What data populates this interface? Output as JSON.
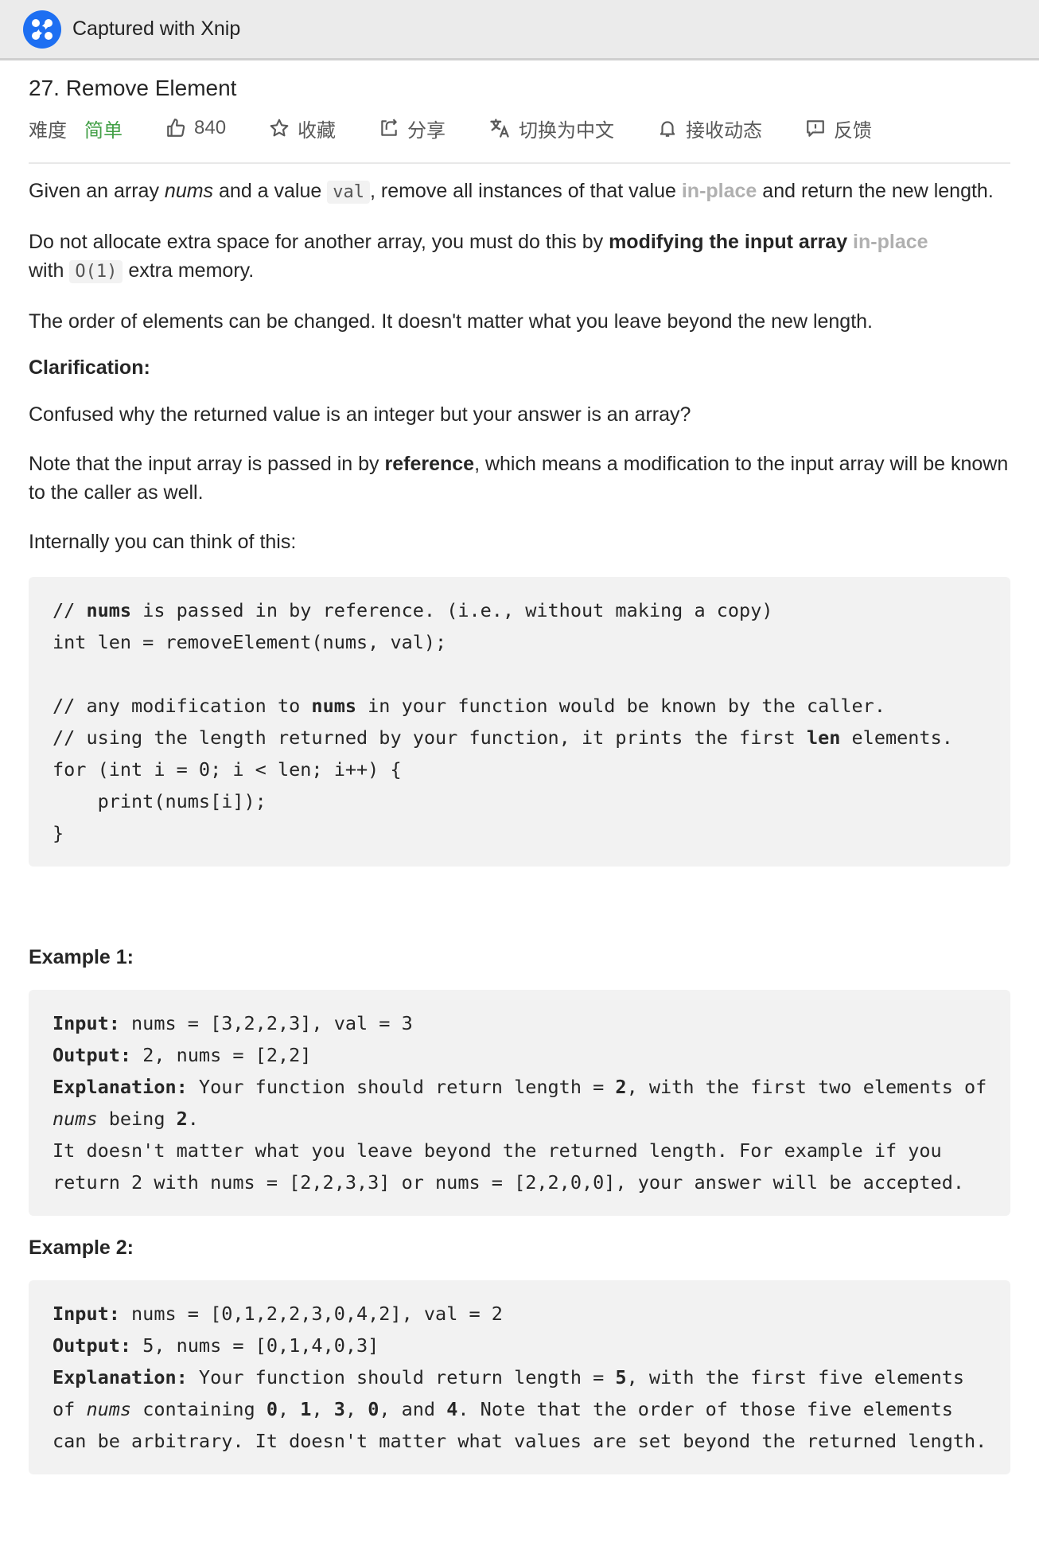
{
  "window": {
    "title": "Captured with Xnip"
  },
  "problem": {
    "title": "27. Remove Element",
    "meta": {
      "difficulty_label": "难度",
      "difficulty_value": "简单",
      "likes": "840",
      "favorite": "收藏",
      "share": "分享",
      "switch_lang": "切换为中文",
      "subscribe": "接收动态",
      "feedback": "反馈"
    },
    "colors": {
      "difficulty": "#43a047",
      "muted_link": "#b0b0b0",
      "code_bg": "#f2f2f2"
    },
    "p1": {
      "a": "Given an array ",
      "nums": "nums",
      "b": " and a value ",
      "val": "val",
      "c": ", remove all instances of that value ",
      "inplace": "in-place",
      "d": " and return the new length."
    },
    "p2": {
      "a": "Do not allocate extra space for another array, you must do this by ",
      "bold": "modifying the input array",
      "inplace": " in-place",
      "b": " with ",
      "o1": "O(1)",
      "c": " extra memory."
    },
    "p3": "The order of elements can be changed. It doesn't matter what you leave beyond the new length.",
    "clarification_heading": "Clarification:",
    "p4": "Confused why the returned value is an integer but your answer is an array?",
    "p5": {
      "a": "Note that the input array is passed in by ",
      "bold": "reference",
      "b": ", which means a modification to the input array will be known to the caller as well."
    },
    "p6": "Internally you can think of this:",
    "code": {
      "l1a": "// ",
      "l1b": "nums",
      "l1c": " is passed in by reference. (i.e., without making a copy)",
      "l2": "int len = removeElement(nums, val);",
      "l3a": "// any modification to ",
      "l3b": "nums",
      "l3c": " in your function would be known by the caller.",
      "l4a": "// using the length returned by your function, it prints the first ",
      "l4b": "len",
      "l4c": " elements.",
      "l5": "for (int i = 0; i < len; i++) {",
      "l6": "    print(nums[i]);",
      "l7": "}"
    },
    "example1": {
      "heading": "Example 1:",
      "input_label": "Input:",
      "input": " nums = [3,2,2,3], val = 3",
      "output_label": "Output:",
      "output": " 2, nums = [2,2]",
      "expl_label": "Explanation:",
      "e1": " Your function should return length = ",
      "e1b": "2",
      "e2": ", with the first two elements of",
      "e3": "nums",
      "e4": " being ",
      "e4b": "2",
      "e5": ".",
      "e6": "It doesn't matter what you leave beyond the returned length. For example if you",
      "e7": "return 2 with nums = [2,2,3,3] or nums = [2,2,0,0], your answer will be accepted."
    },
    "example2": {
      "heading": "Example 2:",
      "input_label": "Input:",
      "input": " nums = [0,1,2,2,3,0,4,2], val = 2",
      "output_label": "Output:",
      "output": " 5, nums = [0,1,4,0,3]",
      "expl_label": "Explanation:",
      "e1": " Your function should return length = ",
      "e1b": "5",
      "e2": ", with the first five elements",
      "e3a": "of ",
      "e3": "nums",
      "e4": " containing ",
      "n1": "0",
      "sep1": ", ",
      "n2": "1",
      "sep2": ", ",
      "n3": "3",
      "sep3": ", ",
      "n4": "0",
      "sep4": ", and ",
      "n5": "4",
      "e5": ". Note that the order of those five elements",
      "e6": "can be arbitrary. It doesn't matter what values are set beyond the returned length."
    }
  }
}
